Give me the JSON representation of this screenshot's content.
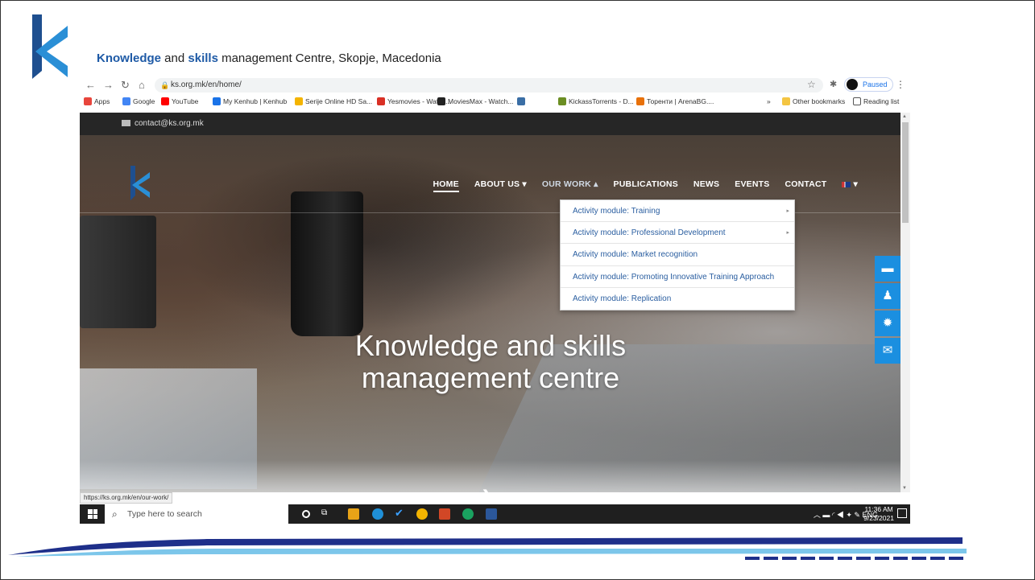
{
  "slide": {
    "title_strong1": "Knowledge",
    "title_mid1": " and ",
    "title_strong2": "skills",
    "title_rest": " management Centre, Skopje, Macedonia"
  },
  "browser": {
    "url": "ks.org.mk/en/home/",
    "profile_status": "Paused",
    "bookmarks": [
      {
        "label": "Apps",
        "color": "#e8453c"
      },
      {
        "label": "Google",
        "color": "#4285f4"
      },
      {
        "label": "YouTube",
        "color": "#ff0000"
      },
      {
        "label": "My Kenhub | Kenhub",
        "color": "#1a73e8"
      },
      {
        "label": "Serije Online HD Sa...",
        "color": "#f4b400"
      },
      {
        "label": "Yesmovies - Watch...",
        "color": "#d93025"
      },
      {
        "label": "MoviesMax - Watch...",
        "color": "#222222"
      },
      {
        "label": "",
        "color": "#3a6ea5"
      },
      {
        "label": "KickassTorrents - D...",
        "color": "#6b8e23"
      },
      {
        "label": "Торенти | ArenaBG....",
        "color": "#e8710a"
      }
    ],
    "more_bookmarks": "»",
    "other_bookmarks": "Other bookmarks",
    "reading_list": "Reading list",
    "status_url": "https://ks.org.mk/en/our-work/"
  },
  "site": {
    "contact_email": "contact@ks.org.mk",
    "menu": [
      {
        "label": "HOME"
      },
      {
        "label": "ABOUT US ▾"
      },
      {
        "label": "OUR WORK ▴"
      },
      {
        "label": "PUBLICATIONS"
      },
      {
        "label": "NEWS"
      },
      {
        "label": "EVENTS"
      },
      {
        "label": "CONTACT"
      }
    ],
    "dropdown": [
      {
        "label": "Activity module: Training",
        "submenu": "▸"
      },
      {
        "label": "Activity module: Professional Development",
        "submenu": "▸"
      },
      {
        "label": "Activity module: Market recognition",
        "submenu": ""
      },
      {
        "label": "Activity module: Promoting Innovative Training Approach",
        "submenu": ""
      },
      {
        "label": "Activity module: Replication",
        "submenu": ""
      }
    ],
    "hero_line1": "Knowledge and skills",
    "hero_line2": "management centre",
    "side_icons": [
      "book-icon",
      "reader-icon",
      "gear-icon",
      "mail-icon"
    ],
    "accent_color": "#1b8fe0"
  },
  "taskbar": {
    "search_placeholder": "Type here to search",
    "language": "ENG",
    "time": "11:36 AM",
    "date": "9/23/2021",
    "notifications": "8"
  }
}
